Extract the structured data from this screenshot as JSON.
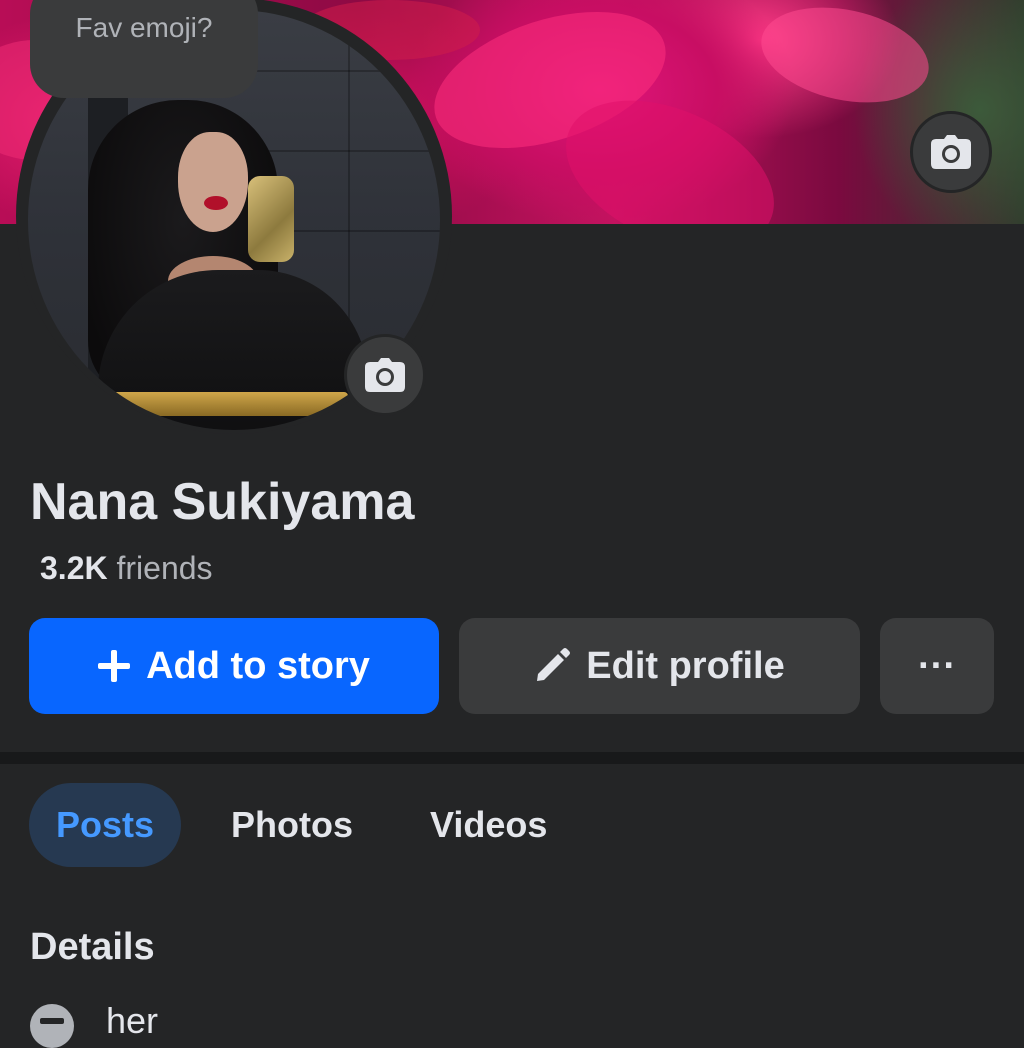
{
  "profile": {
    "bubble_text": "Fav emoji?",
    "name": "Nana Sukiyama",
    "friends_count": "3.2K",
    "friends_label": "friends"
  },
  "actions": {
    "add_story_label": "Add to story",
    "edit_profile_label": "Edit profile",
    "more_label": "···"
  },
  "tabs": [
    {
      "label": "Posts",
      "selected": true
    },
    {
      "label": "Photos",
      "selected": false
    },
    {
      "label": "Videos",
      "selected": false
    }
  ],
  "details": {
    "heading": "Details",
    "first_item": "her"
  },
  "icons": {
    "cover_camera": "camera-icon",
    "avatar_camera": "camera-icon",
    "add": "plus-icon",
    "edit": "pencil-icon",
    "detail": "profile-detail-icon"
  },
  "colors": {
    "background": "#242526",
    "primary_button": "#0866ff",
    "selected_tab_bg": "#263951",
    "selected_tab_text": "#4599ff"
  }
}
